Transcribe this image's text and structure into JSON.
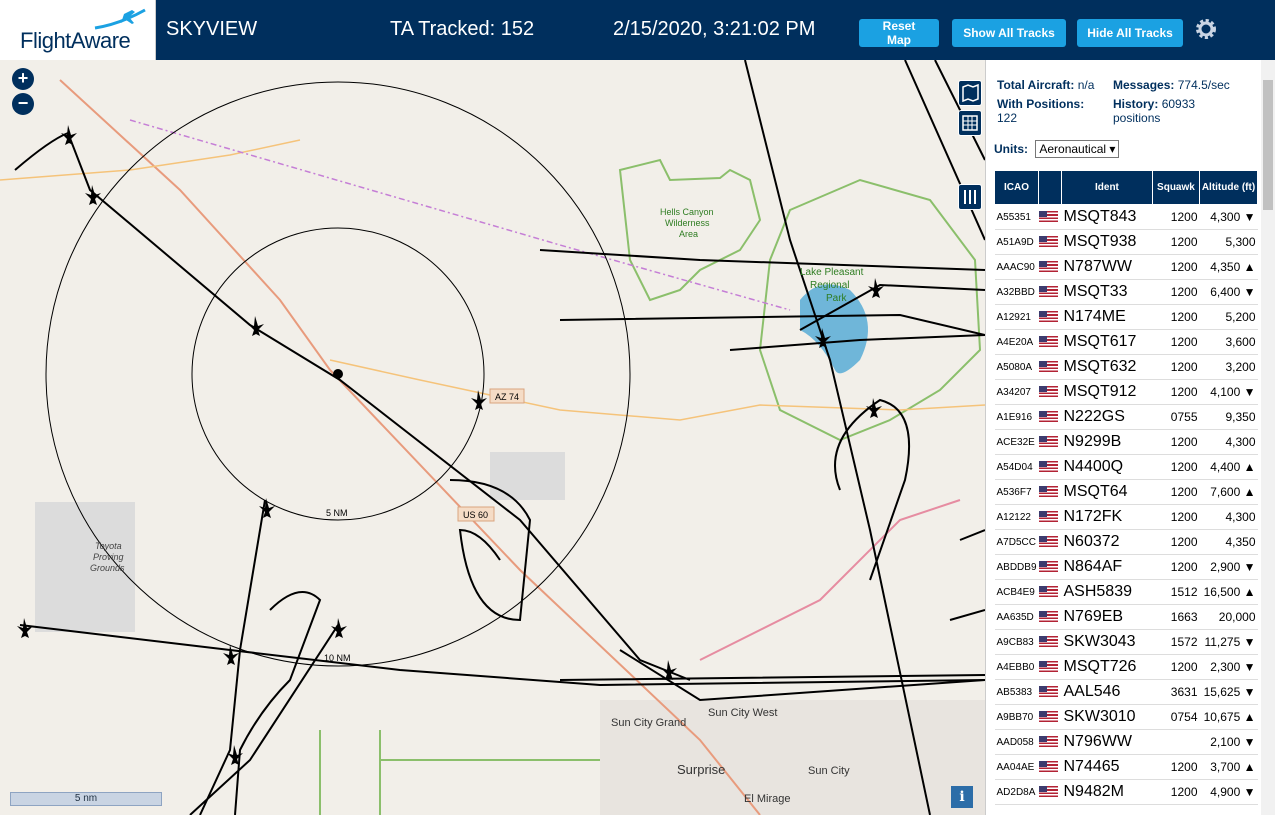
{
  "header": {
    "logo": "FlightAware",
    "app_title": "SKYVIEW",
    "ta_tracked": "TA Tracked: 152",
    "datetime": "2/15/2020, 3:21:02 PM",
    "buttons": {
      "reset_map": "Reset Map",
      "show_all": "Show All Tracks",
      "hide_all": "Hide All Tracks"
    }
  },
  "map": {
    "zoom_in": "+",
    "zoom_out": "−",
    "scale_label": "5 nm",
    "info_label": "i",
    "labels": {
      "ring_inner": "5 NM",
      "ring_outer": "10 NM",
      "az74": "AZ 74",
      "us60": "US 60",
      "hells_canyon": "Hells Canyon",
      "wilderness": "Wilderness",
      "area": "Area",
      "lake_pleasant": "Lake Pleasant",
      "regional": "Regional",
      "park": "Park",
      "toyota": "Toyota",
      "proving": "Proving",
      "grounds": "Grounds",
      "sun_city_grand": "Sun City Grand",
      "sun_city_west": "Sun City West",
      "surprise": "Surprise",
      "sun_city": "Sun City",
      "el_mirage": "El Mirage"
    }
  },
  "panel": {
    "total_aircraft_label": "Total Aircraft:",
    "total_aircraft_value": "n/a",
    "with_positions_label": "With Positions:",
    "with_positions_value": "122",
    "messages_label": "Messages:",
    "messages_value": "774.5/sec",
    "history_label": "History:",
    "history_value": "60933",
    "history_unit": "positions",
    "units_label": "Units:",
    "units_value": "Aeronautical ▾",
    "columns": [
      "ICAO",
      "",
      "Ident",
      "Squawk",
      "Altitude (ft)"
    ],
    "rows": [
      {
        "icao": "A55351",
        "ident": "MSQT843",
        "squawk": "1200",
        "alt": "4,300 ▼"
      },
      {
        "icao": "A51A9D",
        "ident": "MSQT938",
        "squawk": "1200",
        "alt": "5,300"
      },
      {
        "icao": "AAAC90",
        "ident": "N787WW",
        "squawk": "1200",
        "alt": "4,350 ▲"
      },
      {
        "icao": "A32BBD",
        "ident": "MSQT33",
        "squawk": "1200",
        "alt": "6,400 ▼"
      },
      {
        "icao": "A12921",
        "ident": "N174ME",
        "squawk": "1200",
        "alt": "5,200"
      },
      {
        "icao": "A4E20A",
        "ident": "MSQT617",
        "squawk": "1200",
        "alt": "3,600"
      },
      {
        "icao": "A5080A",
        "ident": "MSQT632",
        "squawk": "1200",
        "alt": "3,200"
      },
      {
        "icao": "A34207",
        "ident": "MSQT912",
        "squawk": "1200",
        "alt": "4,100 ▼"
      },
      {
        "icao": "A1E916",
        "ident": "N222GS",
        "squawk": "0755",
        "alt": "9,350"
      },
      {
        "icao": "ACE32E",
        "ident": "N9299B",
        "squawk": "1200",
        "alt": "4,300"
      },
      {
        "icao": "A54D04",
        "ident": "N4400Q",
        "squawk": "1200",
        "alt": "4,400 ▲"
      },
      {
        "icao": "A536F7",
        "ident": "MSQT64",
        "squawk": "1200",
        "alt": "7,600 ▲"
      },
      {
        "icao": "A12122",
        "ident": "N172FK",
        "squawk": "1200",
        "alt": "4,300"
      },
      {
        "icao": "A7D5CC",
        "ident": "N60372",
        "squawk": "1200",
        "alt": "4,350"
      },
      {
        "icao": "ABDDB9",
        "ident": "N864AF",
        "squawk": "1200",
        "alt": "2,900 ▼"
      },
      {
        "icao": "ACB4E9",
        "ident": "ASH5839",
        "squawk": "1512",
        "alt": "16,500 ▲"
      },
      {
        "icao": "AA635D",
        "ident": "N769EB",
        "squawk": "1663",
        "alt": "20,000"
      },
      {
        "icao": "A9CB83",
        "ident": "SKW3043",
        "squawk": "1572",
        "alt": "11,275 ▼"
      },
      {
        "icao": "A4EBB0",
        "ident": "MSQT726",
        "squawk": "1200",
        "alt": "2,300 ▼"
      },
      {
        "icao": "AB5383",
        "ident": "AAL546",
        "squawk": "3631",
        "alt": "15,625 ▼"
      },
      {
        "icao": "A9BB70",
        "ident": "SKW3010",
        "squawk": "0754",
        "alt": "10,675 ▲"
      },
      {
        "icao": "AAD058",
        "ident": "N796WW",
        "squawk": "",
        "alt": "2,100 ▼"
      },
      {
        "icao": "AA04AE",
        "ident": "N74465",
        "squawk": "1200",
        "alt": "3,700 ▲"
      },
      {
        "icao": "AD2D8A",
        "ident": "N9482M",
        "squawk": "1200",
        "alt": "4,900 ▼"
      }
    ]
  },
  "colors": {
    "header_bg": "#002f5d",
    "button": "#1ba1e2",
    "lake": "#6fb6d9",
    "park": "#8bbf6b"
  }
}
